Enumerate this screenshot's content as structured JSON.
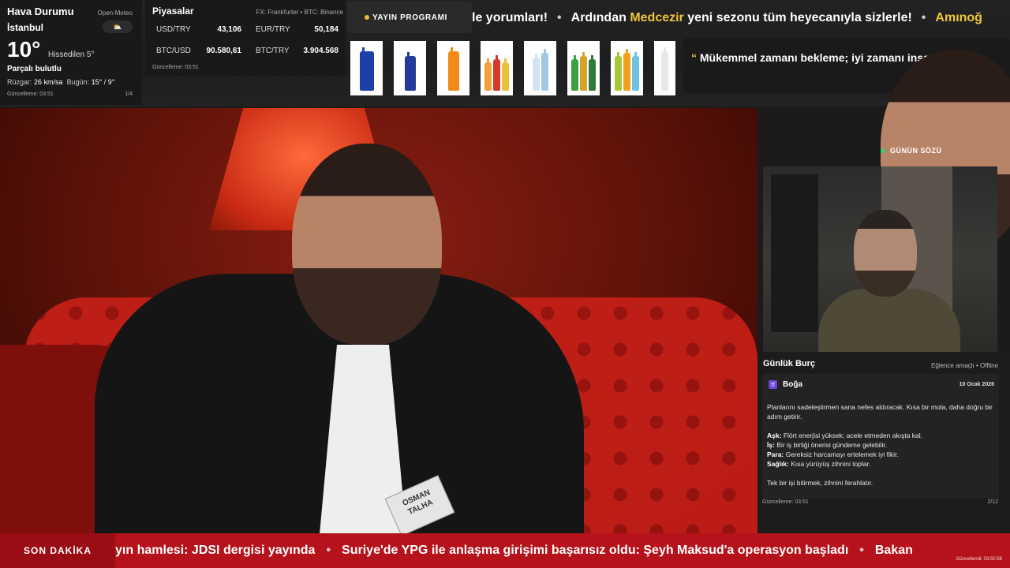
{
  "weather": {
    "title": "Hava Durumu",
    "source": "Open-Meteo",
    "city": "İstanbul",
    "temp": "10°",
    "feels": "Hissedilen 5°",
    "condition": "Parçalı bulutlu",
    "wind_label": "Rüzgar:",
    "wind_value": "26 km/sa",
    "today_label": "Bugün:",
    "today_value": "15° / 9°",
    "updated": "Güncelleme: 03:51",
    "page": "1/4",
    "icon": "partly-cloudy-icon"
  },
  "markets": {
    "title": "Piyasalar",
    "source": "FX: Frankfurter • BTC: Binance",
    "rows": [
      {
        "k": "USD/TRY",
        "v": "43,106"
      },
      {
        "k": "EUR/TRY",
        "v": "50,184"
      },
      {
        "k": "BTC/USD",
        "v": "90.580,61"
      },
      {
        "k": "BTC/TRY",
        "v": "3.904.568"
      }
    ],
    "updated": "Güncelleme: 03:51"
  },
  "schedule": {
    "label": "YAYIN PROGRAMI"
  },
  "top_ticker": {
    "items": [
      "le yorumları!",
      "Ardından",
      "Medcezir",
      "yeni sezonu tüm heyecanıyla sizlerle!",
      "Amınoğ"
    ]
  },
  "quote": {
    "head": "GÜNÜN SÖZÜ",
    "open": "“",
    "text": "Mükemmel zamanı bekleme; iyi zamanı inşa et.",
    "close": "”"
  },
  "nametag": {
    "line1": "OSMAN",
    "line2": "TALHA"
  },
  "horoscope": {
    "title": "Günlük Burç",
    "tag": "Eğlence amaçlı • Offline",
    "sign": "Boğa",
    "sign_icon": "taurus-icon",
    "date": "10 Ocak 2026",
    "intro": "Planlarını sadeleştirmen sana nefes aldıracak. Kısa bir mola, daha doğru bir adım getirir.",
    "lines": [
      {
        "k": "Aşk:",
        "v": "Flört enerjisi yüksek; acele etmeden akışta kal."
      },
      {
        "k": "İş:",
        "v": "Bir iş birliği önerisi gündeme gelebilir."
      },
      {
        "k": "Para:",
        "v": "Gereksiz harcamayı ertelemek iyi fikir."
      },
      {
        "k": "Sağlık:",
        "v": "Kısa yürüyüş zihnini toplar."
      }
    ],
    "outro": "Tek bir işi bitirmek, zihnini ferahlatır.",
    "updated": "Güncelleme: 03:51",
    "page": "2/12"
  },
  "breaking": {
    "label": "SON DAKİKA",
    "items": [
      "yın hamlesi: JDSI dergisi yayında",
      "Suriye'de YPG ile anlaşma girişimi başarısız oldu: Şeyh Maksud'a operasyon başladı",
      "Bakan"
    ],
    "updated": "Güncellendi: 03:50:58"
  },
  "colors": {
    "accent_yellow": "#f0c53b",
    "breaking_red": "#b5121b",
    "quote_dot": "#3ad26a"
  }
}
